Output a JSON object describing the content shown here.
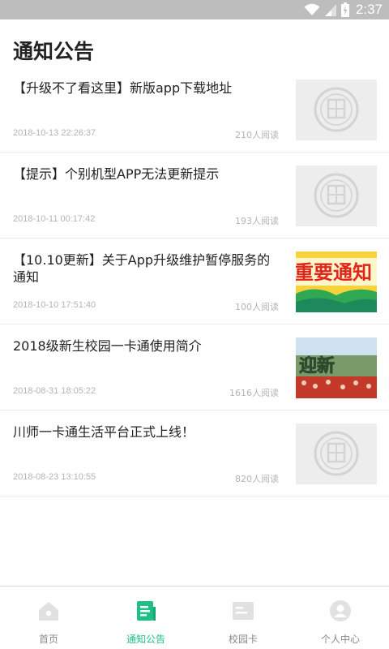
{
  "status_bar": {
    "time": "2:37"
  },
  "page": {
    "title": "通知公告"
  },
  "news": [
    {
      "title": "【升级不了看这里】新版app下载地址",
      "date": "2018-10-13 22:26:37",
      "reads": "210人阅读",
      "thumb": "school-seal-placeholder"
    },
    {
      "title": "【提示】个别机型APP无法更新提示",
      "date": "2018-10-11 00:17:42",
      "reads": "193人阅读",
      "thumb": "school-seal-placeholder"
    },
    {
      "title": "【10.10更新】关于App升级维护暂停服务的通知",
      "date": "2018-10-10 17:51:40",
      "reads": "100人阅读",
      "thumb": "important-notice-banner",
      "thumb_text": "重要通知"
    },
    {
      "title": "2018级新生校园一卡通使用简介",
      "date": "2018-08-31 18:05:22",
      "reads": "1616人阅读",
      "thumb": "welcome-freshmen-photo",
      "thumb_text": "迎新"
    },
    {
      "title": "川师一卡通生活平台正式上线！",
      "date": "2018-08-23 13:10:55",
      "reads": "820人阅读",
      "thumb": "school-seal-placeholder"
    }
  ],
  "tabs": [
    {
      "label": "首页",
      "icon": "home-icon",
      "active": false
    },
    {
      "label": "通知公告",
      "icon": "notice-icon",
      "active": true
    },
    {
      "label": "校园卡",
      "icon": "card-icon",
      "active": false
    },
    {
      "label": "个人中心",
      "icon": "profile-icon",
      "active": false
    }
  ],
  "colors": {
    "accent": "#1fbf86",
    "inactive": "#8a8a8a",
    "status_bar": "#bdbdbd",
    "meta_text": "#b4b4b4"
  }
}
